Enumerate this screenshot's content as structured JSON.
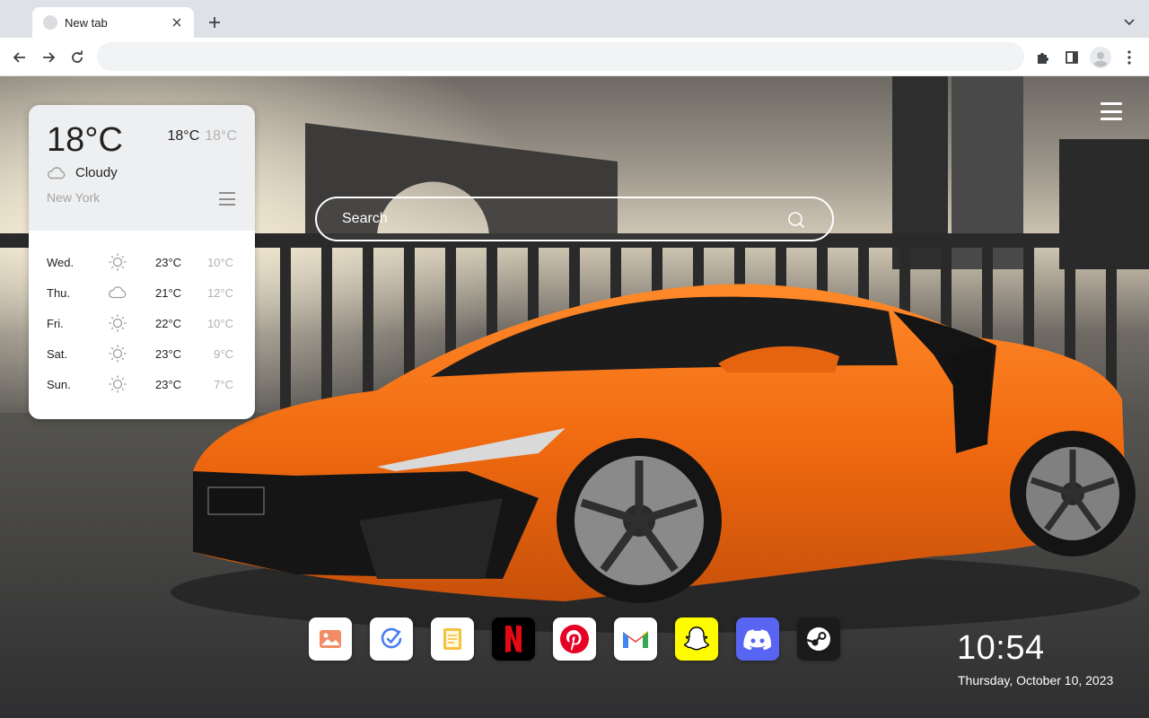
{
  "browser": {
    "tab": {
      "title": "New tab",
      "close_glyph": "✕"
    },
    "new_tab_glyph": "+",
    "omnibox": {
      "value": ""
    }
  },
  "weather": {
    "current_temp": "18°C",
    "high": "18°C",
    "low": "18°C",
    "condition": "Cloudy",
    "city": "New York",
    "forecast": [
      {
        "day": "Wed.",
        "icon": "sun-icon",
        "high": "23°C",
        "low": "10°C"
      },
      {
        "day": "Thu.",
        "icon": "cloud-icon",
        "high": "21°C",
        "low": "12°C"
      },
      {
        "day": "Fri.",
        "icon": "sun-icon",
        "high": "22°C",
        "low": "10°C"
      },
      {
        "day": "Sat.",
        "icon": "sun-icon",
        "high": "23°C",
        "low": "9°C"
      },
      {
        "day": "Sun.",
        "icon": "sun-icon",
        "high": "23°C",
        "low": "7°C"
      }
    ]
  },
  "search": {
    "placeholder": "Search"
  },
  "dock": {
    "apps": [
      "photos-icon",
      "tasks-icon",
      "notes-icon",
      "netflix-icon",
      "pinterest-icon",
      "gmail-icon",
      "snapchat-icon",
      "discord-icon",
      "steam-icon"
    ]
  },
  "clock": {
    "time": "10:54",
    "date": "Thursday, October 10, 2023"
  },
  "colors": {
    "accent_orange": "#ff6a13",
    "netflix_red": "#e50914",
    "pinterest_red": "#e60023",
    "snapchat_yellow": "#fffc00",
    "discord_blurple": "#5865f2"
  }
}
